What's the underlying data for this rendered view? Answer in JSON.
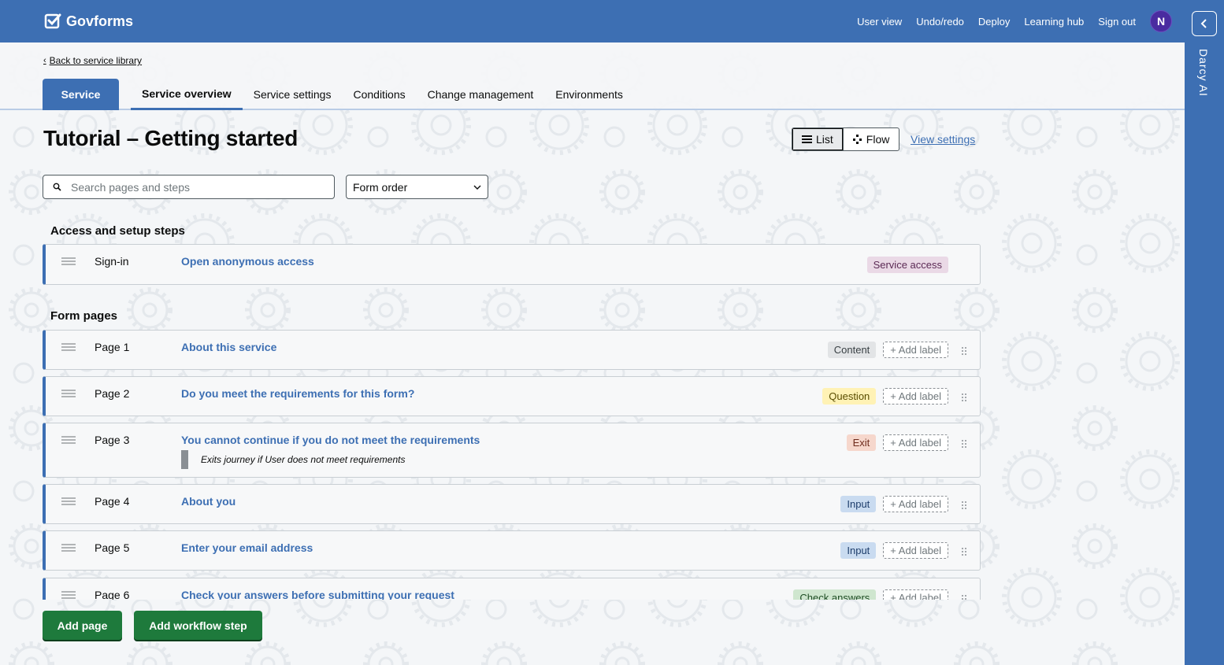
{
  "header": {
    "brand": "Govforms",
    "nav": [
      "User view",
      "Undo/redo",
      "Deploy",
      "Learning hub",
      "Sign out"
    ],
    "avatar_initial": "N"
  },
  "side_panel": {
    "label": "Darcy AI"
  },
  "breadcrumb": {
    "back_label": "Back to service library"
  },
  "tabs": {
    "service_label": "Service",
    "items": [
      "Service overview",
      "Service settings",
      "Conditions",
      "Change management",
      "Environments"
    ],
    "active": "Service overview"
  },
  "page": {
    "title": "Tutorial – Getting started",
    "view_toggle": {
      "list": "List",
      "flow": "Flow",
      "selected": "List"
    },
    "view_settings": "View settings"
  },
  "filters": {
    "search_placeholder": "Search pages and steps",
    "order_value": "Form order"
  },
  "access_section": {
    "heading": "Access and setup steps",
    "rows": [
      {
        "num": "Sign-in",
        "title": "Open anonymous access",
        "tag": "Service access"
      }
    ]
  },
  "form_section": {
    "heading": "Form pages",
    "add_label": "+ Add label",
    "rows": [
      {
        "num": "Page 1",
        "title": "About this service",
        "tag": "Content"
      },
      {
        "num": "Page 2",
        "title": "Do you meet the requirements for this form?",
        "tag": "Question"
      },
      {
        "num": "Page 3",
        "title": "You cannot continue if you do not meet the requirements",
        "tag": "Exit",
        "note": "Exits journey if User does not meet requirements"
      },
      {
        "num": "Page 4",
        "title": "About you",
        "tag": "Input"
      },
      {
        "num": "Page 5",
        "title": "Enter your email address",
        "tag": "Input"
      },
      {
        "num": "Page 6",
        "title": "Check your answers before submitting your request",
        "tag": "Check answers"
      }
    ]
  },
  "actions": {
    "add_page": "Add page",
    "add_workflow_step": "Add workflow step"
  },
  "colors": {
    "brand_blue": "#3d6fb3",
    "action_green": "#1e7a3c",
    "avatar_purple": "#4a2ca0"
  }
}
